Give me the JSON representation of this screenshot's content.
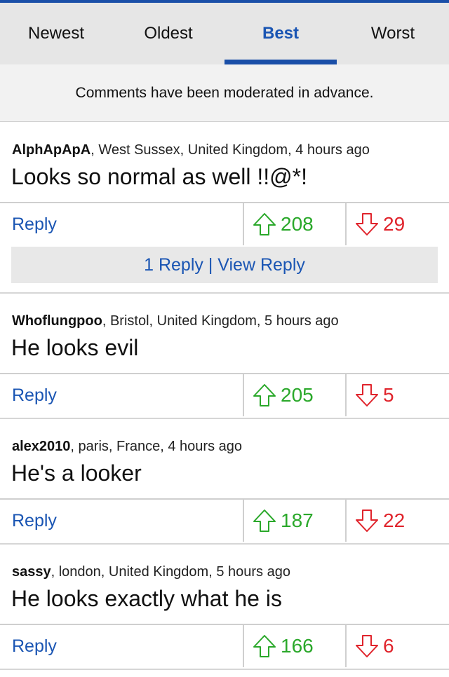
{
  "tabs": [
    {
      "label": "Newest",
      "active": false
    },
    {
      "label": "Oldest",
      "active": false
    },
    {
      "label": "Best",
      "active": true
    },
    {
      "label": "Worst",
      "active": false
    }
  ],
  "notice": "Comments have been moderated in advance.",
  "reply_label": "Reply",
  "comments": [
    {
      "user": "AlphApApA",
      "meta": ", West Sussex, United Kingdom, 4 hours ago",
      "text": "Looks so normal as well !!@*!",
      "up": "208",
      "down": "29",
      "replies_link": "1 Reply | View Reply"
    },
    {
      "user": "Whoflungpoo",
      "meta": ", Bristol, United Kingdom, 5 hours ago",
      "text": "He looks evil",
      "up": "205",
      "down": "5"
    },
    {
      "user": "alex2010",
      "meta": ", paris, France, 4 hours ago",
      "text": "He's a looker",
      "up": "187",
      "down": "22"
    },
    {
      "user": "sassy",
      "meta": ", london, United Kingdom, 5 hours ago",
      "text": "He looks exactly what he is",
      "up": "166",
      "down": "6"
    }
  ],
  "colors": {
    "accent": "#1a55b3",
    "upvote": "#2aa82a",
    "downvote": "#e0242c"
  }
}
